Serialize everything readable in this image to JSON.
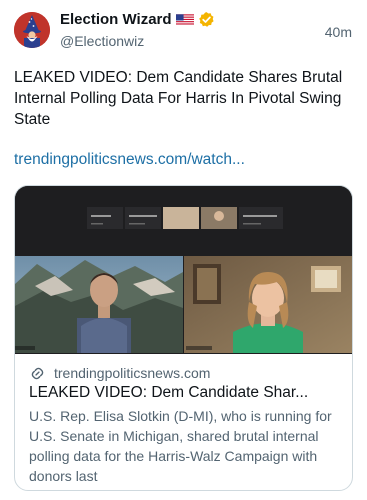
{
  "author": {
    "display_name": "Election Wizard",
    "handle": "@Electionwiz",
    "flag_icon": "us-flag-icon",
    "verified_icon": "verified-badge-icon",
    "verified_color": "#f4b400"
  },
  "timestamp": "40m",
  "post": {
    "text": "LEAKED VIDEO: Dem Candidate Shares Brutal Internal Polling Data For Harris In Pivotal Swing State",
    "link": "trendingpoliticsnews.com/watch..."
  },
  "card": {
    "domain": "trendingpoliticsnews.com",
    "title": "LEAKED VIDEO: Dem Candidate Shar...",
    "description": "U.S. Rep. Elisa Slotkin (D-MI), who is running for U.S. Senate in Michigan, shared brutal internal polling data for the Harris-Walz Campaign with donors last",
    "link_icon": "link-icon"
  },
  "colors": {
    "link": "#1d6fa5",
    "muted_text": "#536471",
    "border": "#cfd9de",
    "avatar_bg": "#c0342b"
  }
}
